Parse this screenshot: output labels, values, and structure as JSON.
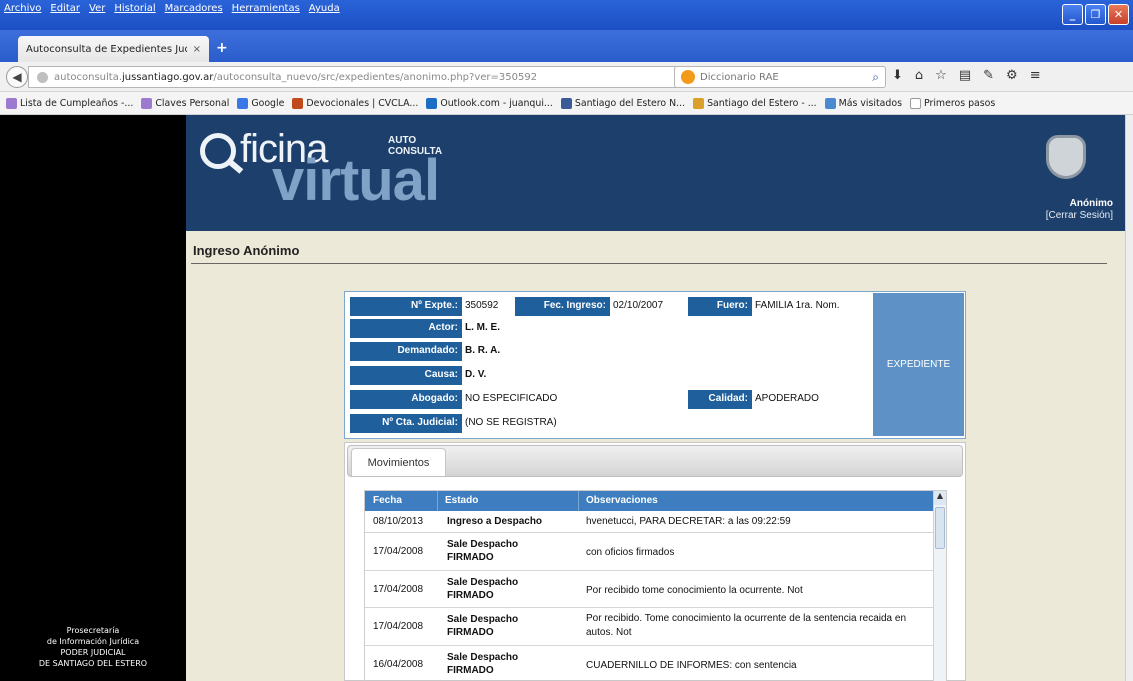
{
  "menu": [
    "Archivo",
    "Editar",
    "Ver",
    "Historial",
    "Marcadores",
    "Herramientas",
    "Ayuda"
  ],
  "tab": {
    "title": "Autoconsulta de Expedientes Judi...",
    "close": "×",
    "new": "+"
  },
  "url": {
    "prefix": "autoconsulta.",
    "domain": "jussantiago.gov.ar",
    "path": "/autoconsulta_nuevo/src/expedientes/anonimo.php?ver=350592",
    "reload": "▿ C"
  },
  "search": {
    "placeholder": "Diccionario RAE"
  },
  "bookmarks": [
    "Lista de Cumpleaños -...",
    "Claves Personal",
    "Google",
    "Devocionales | CVCLA...",
    "Outlook.com - juanqui...",
    "Santiago del Estero N...",
    "Santiago del Estero - ...",
    "Más visitados",
    "Primeros pasos"
  ],
  "banner": {
    "logo_ficina": "ficina",
    "logo_virtual": "virtual",
    "logo_auto": "AUTO",
    "logo_consulta": "CONSULTA",
    "user": "Anónimo",
    "logout": "[Cerrar Sesión]"
  },
  "footer": [
    "Prosecretaría",
    "de Información Jurídica",
    "PODER JUDICIAL",
    "DE SANTIAGO DEL ESTERO"
  ],
  "heading": "Ingreso Anónimo",
  "expediente": {
    "nro_label": "Nº Expte.:",
    "nro": "350592",
    "fec_label": "Fec. Ingreso:",
    "fec": "02/10/2007",
    "fuero_label": "Fuero:",
    "fuero": "FAMILIA 1ra. Nom.",
    "actor_label": "Actor:",
    "actor": "L. M. E.",
    "demandado_label": "Demandado:",
    "demandado": "B. R. A.",
    "causa_label": "Causa:",
    "causa": "D. V.",
    "abogado_label": "Abogado:",
    "abogado": "NO ESPECIFICADO",
    "calidad_label": "Calidad:",
    "calidad": "APODERADO",
    "cta_label": "Nº Cta. Judicial:",
    "cta": "(NO SE REGISTRA)",
    "box": "EXPEDIENTE"
  },
  "movimientos": {
    "tab": "Movimientos",
    "headers": [
      "Fecha",
      "Estado",
      "Observaciones"
    ],
    "rows": [
      {
        "fecha": "08/10/2013",
        "estado": "Ingreso a Despacho",
        "obs": "hvenetucci, PARA DECRETAR: a las 09:22:59"
      },
      {
        "fecha": "17/04/2008",
        "estado": "Sale Despacho FIRMADO",
        "obs": "con oficios firmados"
      },
      {
        "fecha": "17/04/2008",
        "estado": "Sale Despacho FIRMADO",
        "obs": "Por recibido tome conocimiento la ocurrente. Not"
      },
      {
        "fecha": "17/04/2008",
        "estado": "Sale Despacho FIRMADO",
        "obs": "Por recibido. Tome conocimiento la ocurrente de la sentencia recaida en autos. Not"
      },
      {
        "fecha": "16/04/2008",
        "estado": "Sale Despacho FIRMADO",
        "obs": "CUADERNILLO DE INFORMES: con sentencia"
      }
    ]
  }
}
